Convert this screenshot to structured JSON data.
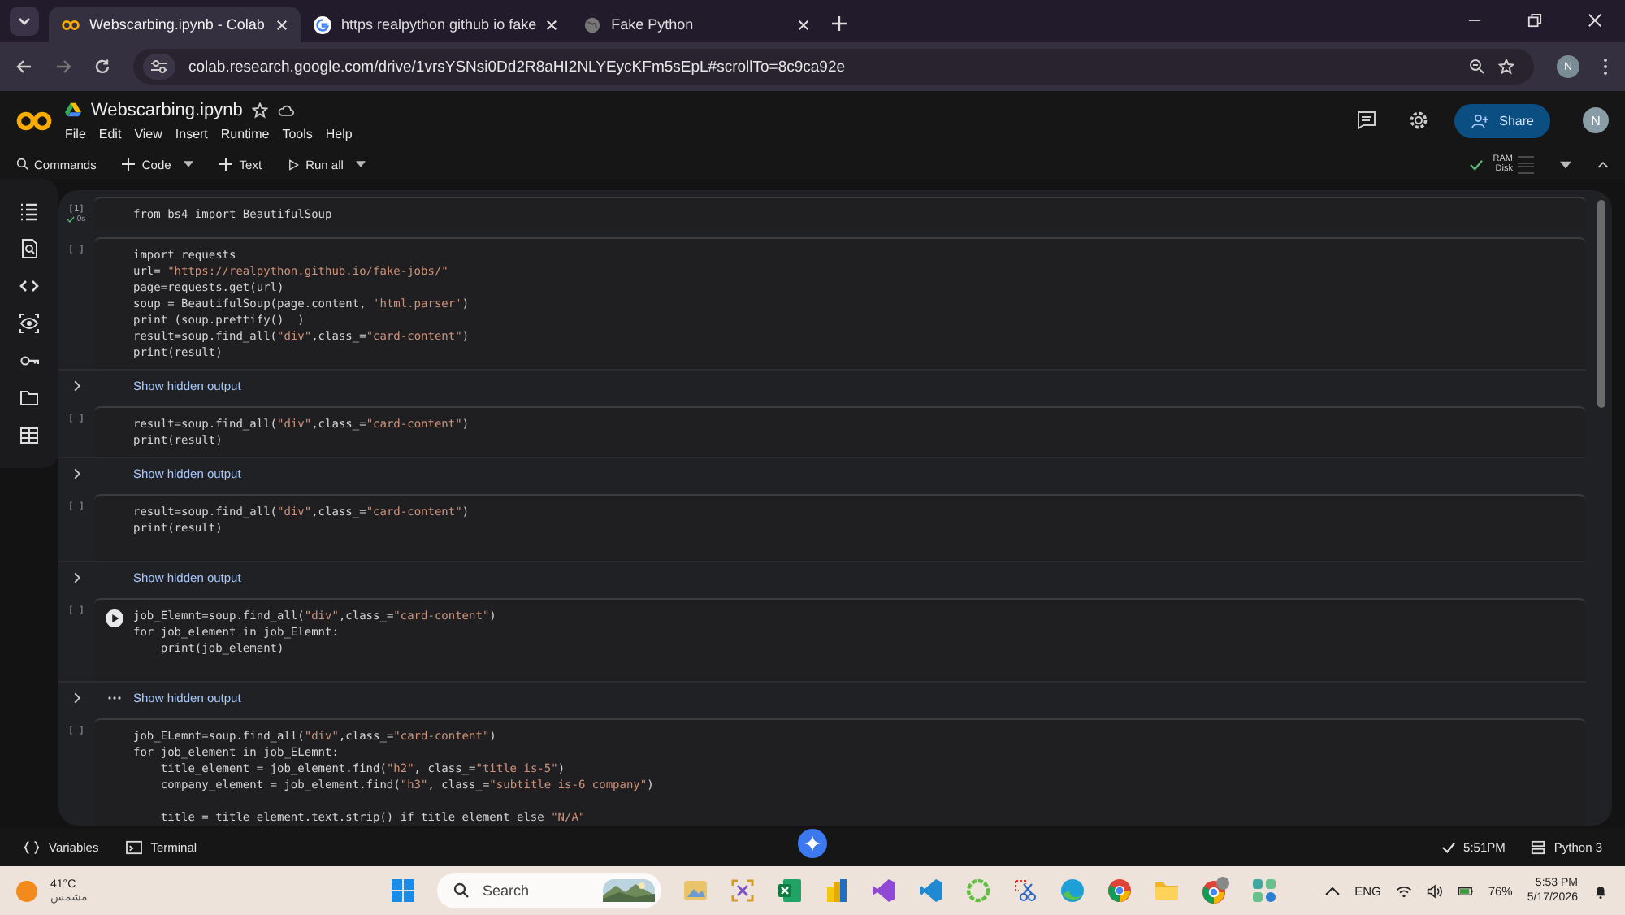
{
  "browser": {
    "tabs": [
      {
        "title": "Webscarbing.ipynb - Colab",
        "kind": "colab",
        "selected": true
      },
      {
        "title": "https realpython github io fake",
        "kind": "google",
        "selected": false
      },
      {
        "title": "Fake Python",
        "kind": "globe",
        "selected": false
      }
    ],
    "address": "colab.research.google.com/drive/1vrsYSNsi0Dd2R8aHI2NLYEycKFm5sEpL#scrollTo=8c9ca92e",
    "profile": "N"
  },
  "notebook": {
    "title": "Webscarbing.ipynb",
    "menu": [
      "File",
      "Edit",
      "View",
      "Insert",
      "Runtime",
      "Tools",
      "Help"
    ],
    "share": "Share",
    "avatar": "N"
  },
  "toolbar": {
    "items": [
      {
        "label": "Commands",
        "kind": "search"
      },
      {
        "label": "Code",
        "kind": "add",
        "caret": true
      },
      {
        "label": "Text",
        "kind": "add",
        "caret": false
      },
      {
        "label": "Run all",
        "kind": "run",
        "caret": true
      }
    ],
    "ram": "RAM",
    "disk": "Disk",
    "connected": true
  },
  "cells": [
    {
      "count": "[1]",
      "time": "0s",
      "running_control": false,
      "lines": [
        "from bs4 import BeautifulSoup"
      ]
    },
    {
      "count": "[ ]",
      "running_control": false,
      "lines": [
        "import requests",
        "url= \"https://realpython.github.io/fake-jobs/\"",
        "page=requests.get(url)",
        "soup = BeautifulSoup(page.content, 'html.parser')",
        "print (soup.prettify()  )",
        "result=soup.find_all(\"div\",class_=\"card-content\")",
        "print(result)"
      ],
      "output": "Show hidden output"
    },
    {
      "count": "[ ]",
      "running_control": false,
      "lines": [
        "result=soup.find_all(\"div\",class_=\"card-content\")",
        "print(result)"
      ],
      "output": "Show hidden output"
    },
    {
      "count": "[ ]",
      "running_control": false,
      "lines": [
        "result=soup.find_all(\"div\",class_=\"card-content\")",
        "print(result)"
      ],
      "trailing_blank": true,
      "output": "Show hidden output"
    },
    {
      "count": "[ ]",
      "running_control": true,
      "lines": [
        "job_Elemnt=soup.find_all(\"div\",class_=\"card-content\")",
        "for job_element in job_Elemnt:",
        "    print(job_element)"
      ],
      "trailing_blank": true,
      "output": "Show hidden output"
    },
    {
      "count": "[ ]",
      "running_control": false,
      "lines": [
        "job_ELemnt=soup.find_all(\"div\",class_=\"card-content\")",
        "for job_element in job_ELemnt:",
        "    title_element = job_element.find(\"h2\", class_=\"title is-5\")",
        "    company_element = job_element.find(\"h3\", class_=\"subtitle is-6 company\")",
        "\n    title = title element.text.strip() if title element else \"N/A\""
      ]
    }
  ],
  "bottom_bar": {
    "variables": "Variables",
    "terminal": "Terminal",
    "saved_time": "5:51PM",
    "runtime": "Python 3"
  },
  "taskbar": {
    "temperature": "41°C",
    "weather": "مشمس",
    "search": "Search",
    "apps": [
      {
        "kind": "photos"
      },
      {
        "kind": "snip"
      },
      {
        "kind": "excel"
      },
      {
        "kind": "powerbi"
      },
      {
        "kind": "vs"
      },
      {
        "kind": "vscode"
      },
      {
        "kind": "ring"
      },
      {
        "kind": "scissors"
      },
      {
        "kind": "edge"
      },
      {
        "kind": "chrome"
      },
      {
        "kind": "folder"
      },
      {
        "kind": "chrome-profile"
      },
      {
        "kind": "tiles"
      }
    ],
    "language": "ENG",
    "battery": "76%",
    "time": "5:53 PM",
    "date": "5/17/2026"
  }
}
